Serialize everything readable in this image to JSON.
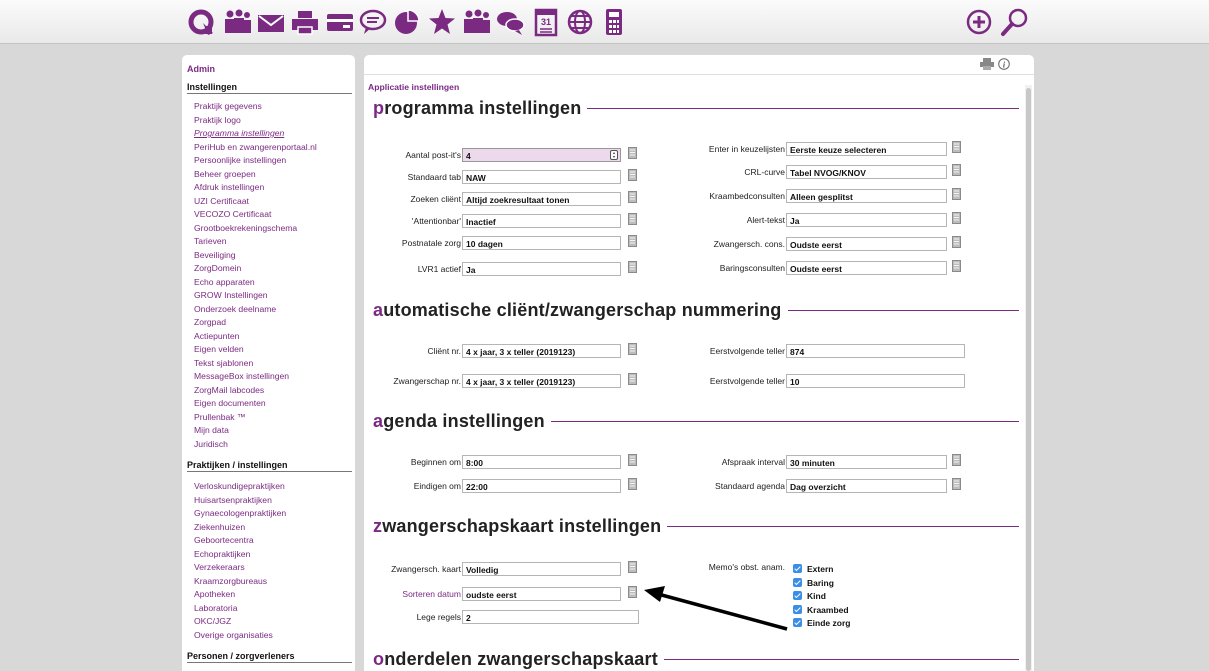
{
  "toolbar": {
    "icons": [
      {
        "name": "refresh-icon"
      },
      {
        "name": "people-icon"
      },
      {
        "name": "mail-icon"
      },
      {
        "name": "printer-icon"
      },
      {
        "name": "card-icon"
      },
      {
        "name": "chat-bubble-icon"
      },
      {
        "name": "pie-chart-icon"
      },
      {
        "name": "star-icon"
      },
      {
        "name": "group-icon"
      },
      {
        "name": "conversation-icon"
      },
      {
        "name": "calendar-icon"
      },
      {
        "name": "globe-icon"
      },
      {
        "name": "calculator-icon"
      },
      {
        "name": "add-icon"
      },
      {
        "name": "search-icon"
      }
    ],
    "calendar_day": "31",
    "accent": "#7b2a82"
  },
  "sidebar": {
    "admin": "Admin",
    "sections": [
      {
        "title": "Instellingen",
        "items": [
          "Praktijk gegevens",
          "Praktijk logo",
          "Programma instellingen",
          "PeriHub en zwangerenportaal.nl",
          "Persoonlijke instellingen",
          "Beheer groepen",
          "Afdruk instellingen",
          "UZI Certificaat",
          "VECOZO Certificaat",
          "Grootboekrekeningschema",
          "Tarieven",
          "Beveiliging",
          "ZorgDomein",
          "Echo apparaten",
          "GROW Instellingen",
          "Onderzoek deelname",
          "Zorgpad",
          "Actiepunten",
          "Eigen velden",
          "Tekst sjablonen",
          "MessageBox instellingen",
          "ZorgMail labcodes",
          "Eigen documenten",
          "Prullenbak ™",
          "Mijn data",
          "Juridisch"
        ]
      },
      {
        "title": "Praktijken / instellingen",
        "items": [
          "Verloskundigepraktijken",
          "Huisartsenpraktijken",
          "Gynaecologenpraktijken",
          "Ziekenhuizen",
          "Geboortecentra",
          "Echopraktijken",
          "Verzekeraars",
          "Kraamzorgbureaus",
          "Apotheken",
          "Laboratoria",
          "OKC/JGZ",
          "Overige organisaties"
        ]
      },
      {
        "title": "Personen / zorgverleners",
        "items": []
      }
    ],
    "active_item": "Programma instellingen"
  },
  "main": {
    "breadcrumb": "Applicatie instellingen",
    "sections": [
      {
        "first": "p",
        "rest": "rogramma instellingen"
      },
      {
        "first": "a",
        "rest": "utomatische cliënt/zwangerschap nummering"
      },
      {
        "first": "a",
        "rest": "genda instellingen"
      },
      {
        "first": "z",
        "rest": "wangerschapskaart instellingen"
      },
      {
        "first": "o",
        "rest": "nderdelen zwangerschapskaart"
      }
    ],
    "fields": {
      "aantal_postits": {
        "label": "Aantal post-it's",
        "value": "4"
      },
      "standaard_tab": {
        "label": "Standaard tab",
        "value": "NAW"
      },
      "zoeken_client": {
        "label": "Zoeken cliënt",
        "value": "Altijd zoekresultaat tonen"
      },
      "attentionbar": {
        "label": "'Attentionbar'",
        "value": "Inactief"
      },
      "postnatale_zorg": {
        "label": "Postnatale zorg",
        "value": "10 dagen"
      },
      "lvr1_actief": {
        "label": "LVR1 actief",
        "value": "Ja"
      },
      "enter_keuzelijsten": {
        "label": "Enter in keuzelijsten",
        "value": "Eerste keuze selecteren"
      },
      "crl_curve": {
        "label": "CRL-curve",
        "value": "Tabel NVOG/KNOV"
      },
      "kraambedconsulten": {
        "label": "Kraambedconsulten",
        "value": "Alleen gesplitst"
      },
      "alert_tekst": {
        "label": "Alert-tekst",
        "value": "Ja"
      },
      "zwangersch_cons": {
        "label": "Zwangersch. cons.",
        "value": "Oudste eerst"
      },
      "baringsconsulten": {
        "label": "Baringsconsulten",
        "value": "Oudste eerst"
      },
      "client_nr": {
        "label": "Cliënt nr.",
        "value": "4 x jaar, 3 x teller (2019123)"
      },
      "zwangerschap_nr": {
        "label": "Zwangerschap nr.",
        "value": "4 x jaar, 3 x teller (2019123)"
      },
      "eerstvolgende_1": {
        "label": "Eerstvolgende teller",
        "value": "874"
      },
      "eerstvolgende_2": {
        "label": "Eerstvolgende teller",
        "value": "10"
      },
      "beginnen_om": {
        "label": "Beginnen om",
        "value": "8:00"
      },
      "eindigen_om": {
        "label": "Eindigen om",
        "value": "22:00"
      },
      "afspraak_interval": {
        "label": "Afspraak interval",
        "value": "30 minuten"
      },
      "standaard_agenda": {
        "label": "Standaard agenda",
        "value": "Dag overzicht"
      },
      "zwangersch_kaart": {
        "label": "Zwangersch. kaart",
        "value": "Volledig"
      },
      "sorteren_datum": {
        "label": "Sorteren datum",
        "value": "oudste eerst"
      },
      "lege_regels": {
        "label": "Lege regels",
        "value": "2"
      },
      "memos_label": "Memo's obst. anam."
    },
    "memos": [
      "Extern",
      "Baring",
      "Kind",
      "Kraambed",
      "Einde zorg"
    ]
  }
}
